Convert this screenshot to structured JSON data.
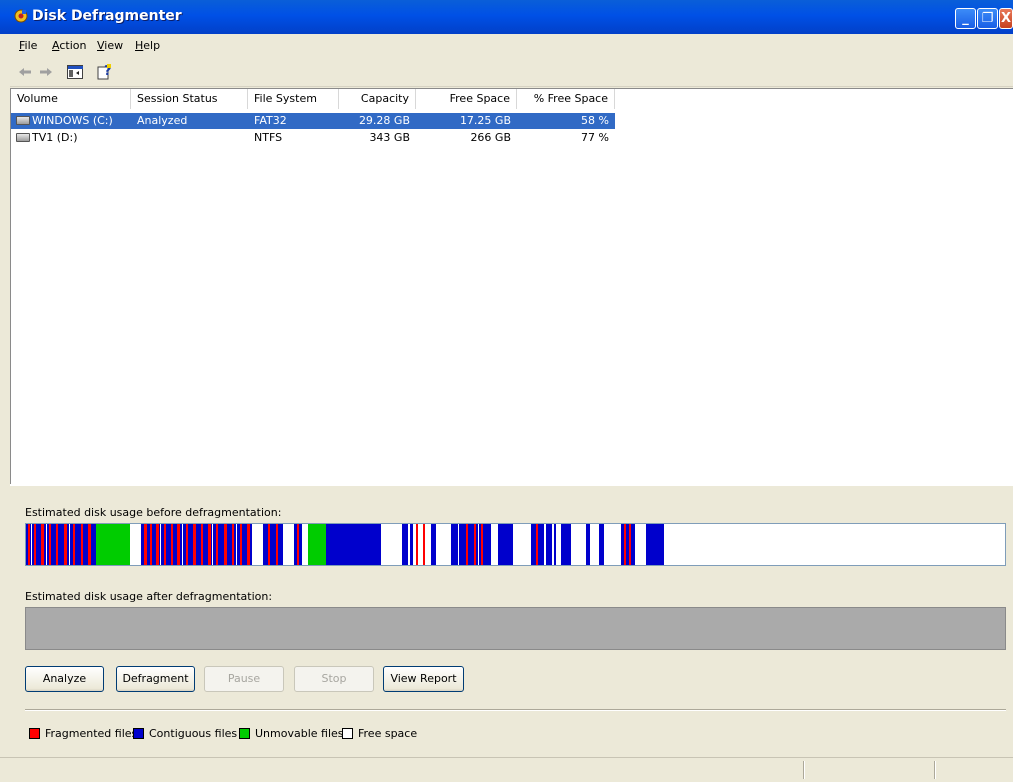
{
  "window": {
    "title": "Disk Defragmenter",
    "minimize_glyph": "_",
    "maximize_glyph": "❐",
    "close_glyph": "X"
  },
  "menu": {
    "file": {
      "accel": "F",
      "rest": "ile"
    },
    "action": {
      "accel": "A",
      "rest": "ction"
    },
    "view": {
      "accel": "V",
      "rest": "iew"
    },
    "help": {
      "accel": "H",
      "rest": "elp"
    }
  },
  "toolbar": {
    "back_icon": "arrow-left-icon",
    "forward_icon": "arrow-right-icon",
    "show_hide_tree_icon": "console-tree-icon",
    "help_icon": "help-icon"
  },
  "table": {
    "columns": [
      "Volume",
      "Session Status",
      "File System",
      "Capacity",
      "Free Space",
      "% Free Space"
    ],
    "rows": [
      {
        "volume": "WINDOWS (C:)",
        "status": "Analyzed",
        "fs": "FAT32",
        "capacity": "29.28 GB",
        "free": "17.25 GB",
        "pct": "58 %",
        "selected": true
      },
      {
        "volume": "TV1 (D:)",
        "status": "",
        "fs": "NTFS",
        "capacity": "343 GB",
        "free": "266 GB",
        "pct": "77 %",
        "selected": false
      }
    ]
  },
  "analysis": {
    "before_label": "Estimated disk usage before defragmentation:",
    "after_label": "Estimated disk usage after defragmentation:"
  },
  "buttons": {
    "analyze": "Analyze",
    "defragment": "Defragment",
    "pause": "Pause",
    "stop": "Stop",
    "view_report": "View Report"
  },
  "legend": {
    "fragmented": "Fragmented files",
    "contiguous": "Contiguous files",
    "unmovable": "Unmovable files",
    "free": "Free space"
  },
  "colors": {
    "fragmented": "#ff0000",
    "contiguous": "#0000cc",
    "unmovable": "#00cc00",
    "free": "#ffffff",
    "selection": "#316ac5",
    "titlebar": "#0050e6"
  }
}
